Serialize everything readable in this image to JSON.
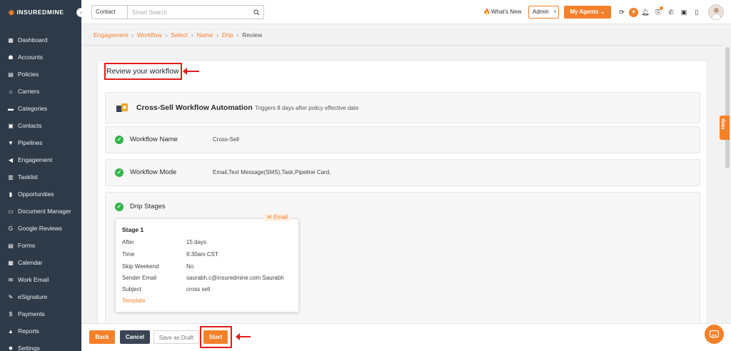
{
  "app": {
    "logo_text": "INSUREDMINE"
  },
  "sidebar": {
    "collapse_icon": "chevron-left-icon",
    "items": [
      {
        "label": "Dashboard",
        "icon": "grid-icon"
      },
      {
        "label": "Accounts",
        "icon": "accounts-icon"
      },
      {
        "label": "Policies",
        "icon": "document-icon"
      },
      {
        "label": "Carriers",
        "icon": "bank-icon"
      },
      {
        "label": "Categories",
        "icon": "folder-icon"
      },
      {
        "label": "Contacts",
        "icon": "contact-card-icon"
      },
      {
        "label": "Pipelines",
        "icon": "funnel-icon"
      },
      {
        "label": "Engagement",
        "icon": "megaphone-icon"
      },
      {
        "label": "Tasklist",
        "icon": "checklist-icon"
      },
      {
        "label": "Opportunities",
        "icon": "bar-chart-icon"
      },
      {
        "label": "Document Manager",
        "icon": "folder-open-icon"
      },
      {
        "label": "Google Reviews",
        "icon": "google-icon"
      },
      {
        "label": "Forms",
        "icon": "form-icon"
      },
      {
        "label": "Calendar",
        "icon": "calendar-icon"
      },
      {
        "label": "Work Email",
        "icon": "envelope-icon"
      },
      {
        "label": "eSignature",
        "icon": "signature-icon"
      },
      {
        "label": "Payments",
        "icon": "dollar-icon"
      },
      {
        "label": "Reports",
        "icon": "line-chart-icon"
      },
      {
        "label": "Settings",
        "icon": "gear-icon"
      }
    ]
  },
  "topbar": {
    "contact_select": "Contact",
    "search_placeholder": "Smart Search",
    "whats_new": "What's New",
    "admin_select": "Admin",
    "my_agents": "My Agents"
  },
  "breadcrumb": [
    {
      "label": "Engagement",
      "current": false
    },
    {
      "label": "Workflow",
      "current": false
    },
    {
      "label": "Select",
      "current": false
    },
    {
      "label": "Name",
      "current": false
    },
    {
      "label": "Drip",
      "current": false
    },
    {
      "label": "Review",
      "current": true
    }
  ],
  "review": {
    "title": "Review your workflow",
    "workflow_title": "Cross-Sell Workflow Automation",
    "workflow_subtitle": "Triggers 8 days after policy effective date",
    "name_label": "Workflow Name",
    "name_value": "Cross-Sell",
    "mode_label": "Workflow Mode",
    "mode_value": "Email,Text Message(SMS),Task,Pipeline Card,",
    "drip_label": "Drip Stages",
    "stage": {
      "tag": "Email",
      "title": "Stage 1",
      "after_label": "After",
      "after_value": "15 days",
      "time_label": "Time",
      "time_value": "9:30am CST",
      "skip_label": "Skip Weekend",
      "skip_value": "No",
      "sender_label": "Sender Email",
      "sender_value": "saurabh.c@insuredmine.com Saurabh",
      "subject_label": "Subject",
      "subject_value": "cross sell",
      "template_link": "Template"
    }
  },
  "footer": {
    "back": "Back",
    "cancel": "Cancel",
    "save_draft": "Save as Draft",
    "start": "Start"
  },
  "help_tab": "Help",
  "colors": {
    "accent": "#f5802a",
    "sidebar_bg": "#2f3a48",
    "success": "#33b34a",
    "annotation_red": "#e21b1b"
  }
}
